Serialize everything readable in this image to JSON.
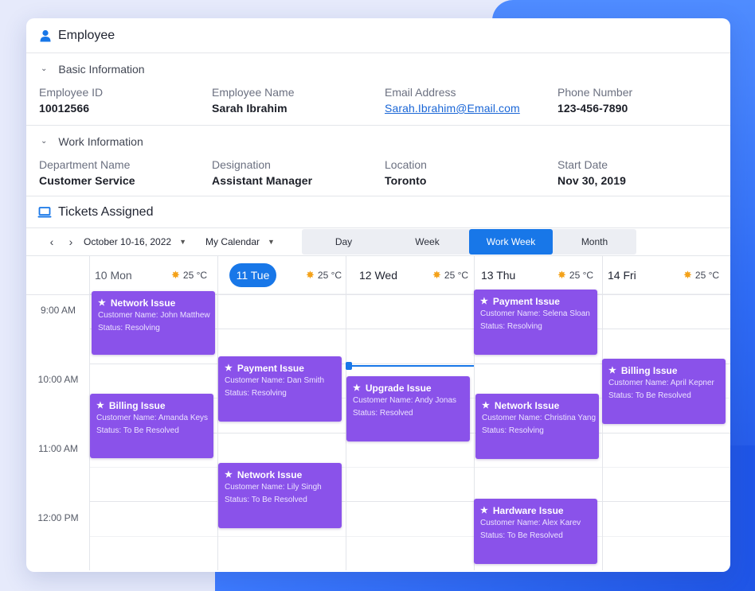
{
  "employee": {
    "title": "Employee",
    "basic_section": "Basic Information",
    "work_section": "Work Information",
    "basic": [
      {
        "label": "Employee ID",
        "value": "10012566"
      },
      {
        "label": "Employee Name",
        "value": "Sarah Ibrahim"
      },
      {
        "label": "Email Address",
        "value": "Sarah.Ibrahim@Email.com"
      },
      {
        "label": "Phone Number",
        "value": "123-456-7890"
      }
    ],
    "work": [
      {
        "label": "Department Name",
        "value": "Customer Service"
      },
      {
        "label": "Designation",
        "value": "Assistant Manager"
      },
      {
        "label": "Location",
        "value": "Toronto"
      },
      {
        "label": "Start Date",
        "value": "Nov 30, 2019"
      }
    ]
  },
  "tickets": {
    "title": "Tickets Assigned",
    "toolbar": {
      "date_range": "October 10-16, 2022",
      "calendar": "My Calendar",
      "views": [
        "Day",
        "Week",
        "Work Week",
        "Month"
      ],
      "active_view": "Work Week"
    },
    "days": [
      {
        "label": "10 Mon",
        "temp": "25 °C"
      },
      {
        "label": "11 Tue",
        "temp": "25 °C",
        "today": true
      },
      {
        "label": "12 Wed",
        "temp": "25 °C"
      },
      {
        "label": "13 Thu",
        "temp": "25 °C"
      },
      {
        "label": "14 Fri",
        "temp": "25 °C"
      }
    ],
    "times": [
      "9:00 AM",
      "10:00 AM",
      "11:00 AM",
      "12:00 PM"
    ],
    "events": [
      {
        "title": "Network Issue",
        "customer": "Customer Name: John Matthew",
        "status": "Status: Resolving"
      },
      {
        "title": "Billing Issue",
        "customer": "Customer Name: Amanda Keys",
        "status": "Status: To Be Resolved"
      },
      {
        "title": "Payment Issue",
        "customer": "Customer Name: Dan Smith",
        "status": "Status: Resolving"
      },
      {
        "title": "Network Issue",
        "customer": "Customer Name: Lily Singh",
        "status": "Status: To Be Resolved"
      },
      {
        "title": "Upgrade Issue",
        "customer": "Customer Name: Andy Jonas",
        "status": "Status: Resolved"
      },
      {
        "title": "Payment Issue",
        "customer": "Customer Name: Selena Sloan",
        "status": "Status: Resolving"
      },
      {
        "title": "Network Issue",
        "customer": "Customer Name: Christina Yang",
        "status": "Status: Resolving"
      },
      {
        "title": "Hardware Issue",
        "customer": "Customer Name: Alex Karev",
        "status": "Status: To Be Resolved"
      },
      {
        "title": "Billing Issue",
        "customer": "Customer Name: April Kepner",
        "status": "Status: To Be Resolved"
      }
    ]
  },
  "colors": {
    "accent": "#1877e8",
    "event": "#8a52ea",
    "link": "#1a66d6"
  }
}
